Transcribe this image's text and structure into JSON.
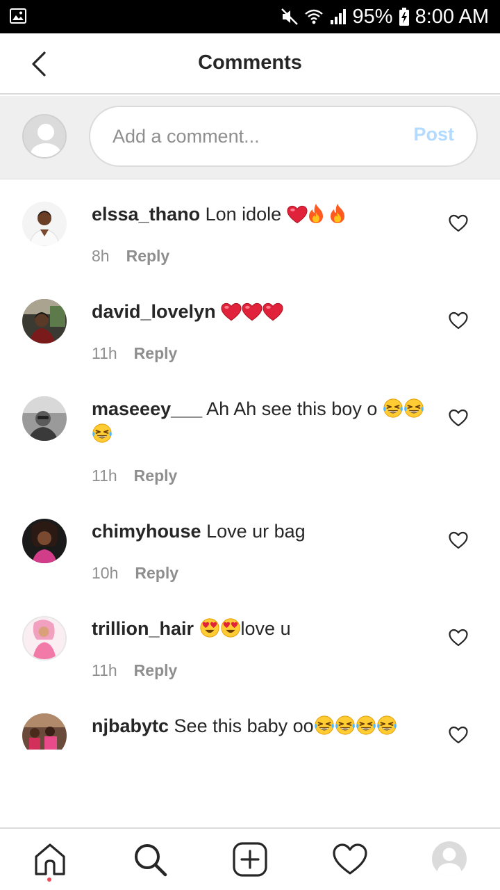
{
  "status_bar": {
    "battery": "95%",
    "time": "8:00 AM"
  },
  "header": {
    "title": "Comments"
  },
  "composer": {
    "placeholder": "Add a comment...",
    "post_label": "Post"
  },
  "comments": [
    {
      "username": "elssa_thano",
      "text": "Lon idole",
      "emojis": [
        "heart-emoji",
        "fire-emoji",
        "fire-emoji"
      ],
      "time": "8h",
      "reply_label": "Reply"
    },
    {
      "username": "david_lovelyn",
      "text": "",
      "emojis": [
        "heart-emoji",
        "heart-emoji",
        "heart-emoji"
      ],
      "time": "11h",
      "reply_label": "Reply"
    },
    {
      "username": "maseeey___",
      "text": "Ah Ah see this boy o",
      "emojis": [
        "tears-of-joy-emoji",
        "tears-of-joy-emoji",
        "tears-of-joy-emoji"
      ],
      "time": "11h",
      "reply_label": "Reply"
    },
    {
      "username": "chimyhouse",
      "text": "Love ur bag",
      "emojis": [],
      "time": "10h",
      "reply_label": "Reply"
    },
    {
      "username": "trillion_hair",
      "text": "love u",
      "emojis": [
        "heart-eyes-emoji",
        "heart-eyes-emoji"
      ],
      "time": "11h",
      "reply_label": "Reply"
    },
    {
      "username": "njbabytc",
      "text": "See this baby oo",
      "emojis": [
        "tears-of-joy-emoji",
        "tears-of-joy-emoji",
        "tears-of-joy-emoji",
        "tears-of-joy-emoji"
      ],
      "time": "",
      "reply_label": ""
    }
  ],
  "bottom_nav": {
    "items": [
      "home-icon",
      "search-icon",
      "add-post-icon",
      "activity-heart-icon",
      "profile-avatar"
    ]
  },
  "colors": {
    "text": "#262626",
    "secondary": "#8e8e8e",
    "post_disabled": "#b3dbff",
    "divider": "#dbdbdb",
    "composer_bg": "#efefef",
    "heart_red": "#ed4956"
  }
}
